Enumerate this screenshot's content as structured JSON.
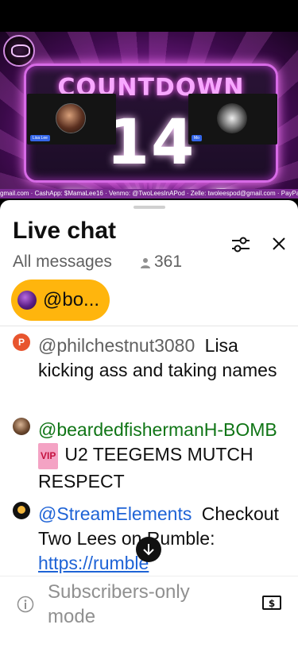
{
  "video": {
    "sign_title": "COUNTDOWN",
    "sign_big": "14 DAYS",
    "ticker": "gmail.com · CashApp: $MamaLee16 · Venmo: @TwoLeesInAPod · Zelle: twoleespod@gmail.com · PayPal: tw",
    "cam_left_tag": "Lisa Lee",
    "cam_right_tag": "Mo"
  },
  "chat": {
    "title": "Live chat",
    "filter": "All messages",
    "viewer_count": "361",
    "pinned": {
      "label": "@bo..."
    },
    "messages": [
      {
        "author": "@philchestnut3080",
        "text": "Lisa kicking ass and taking names",
        "avatar_letter": "P"
      },
      {
        "author": "@beardedfishermanH-BOMB",
        "badge": "VIP",
        "text": "U2 TEEGEMS MUTCH RESPECT"
      },
      {
        "author": "@StreamElements",
        "text": "Checkout Two Lees on Rumble:",
        "link": "https://rumble"
      }
    ],
    "footer": {
      "text": "Subscribers-only mode"
    }
  },
  "colors": {
    "pinned_bg": "#ffb50d",
    "author_green": "#107516",
    "author_blue": "#1e63d6",
    "ticker_bg": "#7b2a93"
  },
  "icons": [
    "filter-icon",
    "close-icon",
    "viewer-icon",
    "arrow-down-icon",
    "info-icon",
    "money-icon"
  ]
}
